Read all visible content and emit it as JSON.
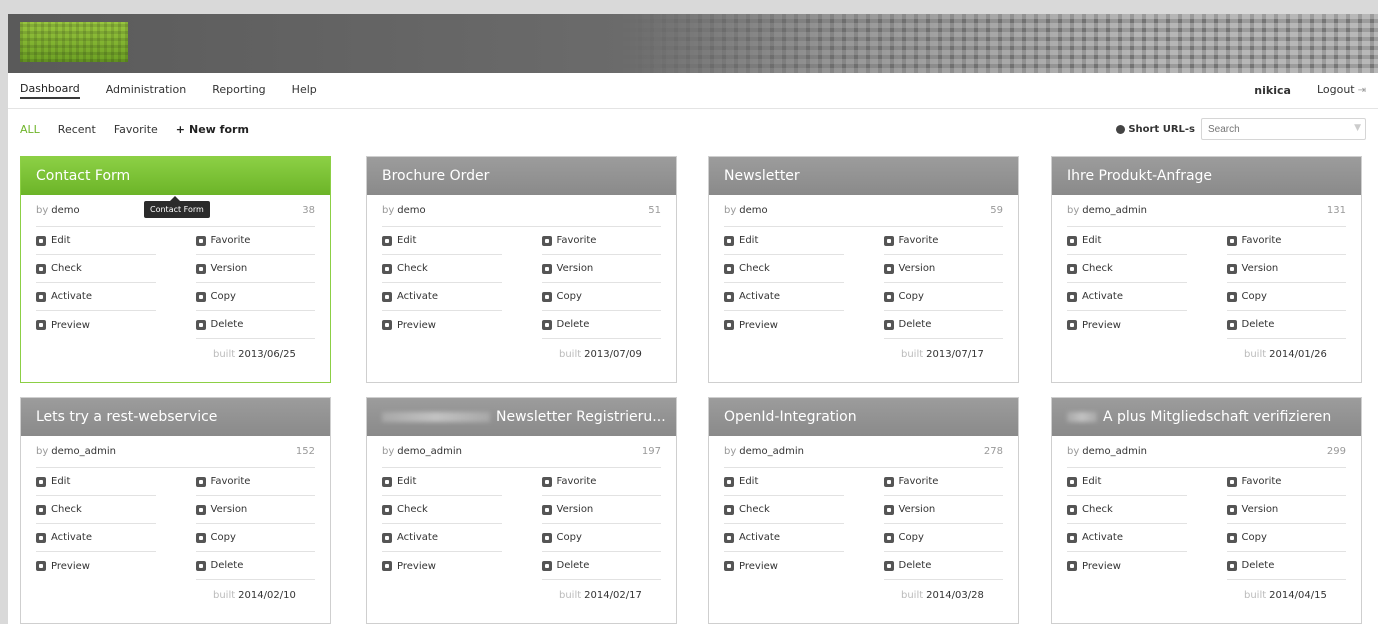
{
  "nav": {
    "items": [
      "Dashboard",
      "Administration",
      "Reporting",
      "Help"
    ],
    "user": "nikica",
    "logout": "Logout"
  },
  "filters": {
    "all": "ALL",
    "recent": "Recent",
    "favorite": "Favorite",
    "new_form": "New form",
    "short_urls": "Short URL-s",
    "search_placeholder": "Search"
  },
  "tooltip": "Contact Form",
  "card_labels": {
    "by": "by",
    "built": "built",
    "edit": "Edit",
    "favorite": "Favorite",
    "check": "Check",
    "version": "Version",
    "activate": "Activate",
    "copy": "Copy",
    "preview": "Preview",
    "delete": "Delete"
  },
  "forms": [
    {
      "title": "Contact Form",
      "owner": "demo",
      "count": "38",
      "built": "2013/06/25"
    },
    {
      "title": "Brochure Order",
      "owner": "demo",
      "count": "51",
      "built": "2013/07/09"
    },
    {
      "title": "Newsletter",
      "owner": "demo",
      "count": "59",
      "built": "2013/07/17"
    },
    {
      "title": "Ihre Produkt-Anfrage",
      "owner": "demo_admin",
      "count": "131",
      "built": "2014/01/26"
    },
    {
      "title": "Lets try a rest-webservice",
      "owner": "demo_admin",
      "count": "152",
      "built": "2014/02/10"
    },
    {
      "title": "Newsletter Registrieru...",
      "owner": "demo_admin",
      "count": "197",
      "built": "2014/02/17"
    },
    {
      "title": "OpenId-Integration",
      "owner": "demo_admin",
      "count": "278",
      "built": "2014/03/28"
    },
    {
      "title": "A plus Mitgliedschaft verifizieren",
      "owner": "demo_admin",
      "count": "299",
      "built": "2014/04/15"
    }
  ],
  "colors": {
    "accent": "#6fb52a",
    "card_header": "#8f8f8f",
    "card_header_selected": "#7cc236"
  }
}
